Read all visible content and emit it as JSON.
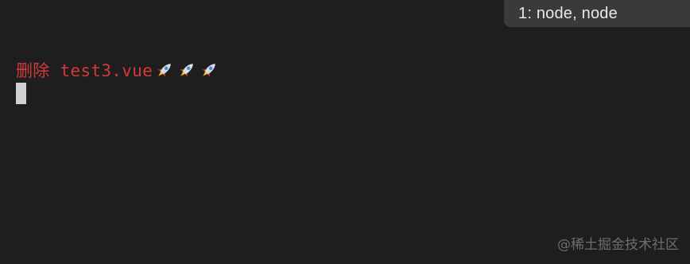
{
  "tab": {
    "label": "1: node, node"
  },
  "output": {
    "text": "删除 test3.vue",
    "emoji_icon": "rocket-icon",
    "emoji_count": 3,
    "text_color": "#d23a3a"
  },
  "cursor": {
    "color": "#d0d0d0"
  },
  "watermark": {
    "text": "@稀土掘金技术社区"
  },
  "colors": {
    "background": "#1e1e1e",
    "tab_background": "#3a3a3a"
  }
}
